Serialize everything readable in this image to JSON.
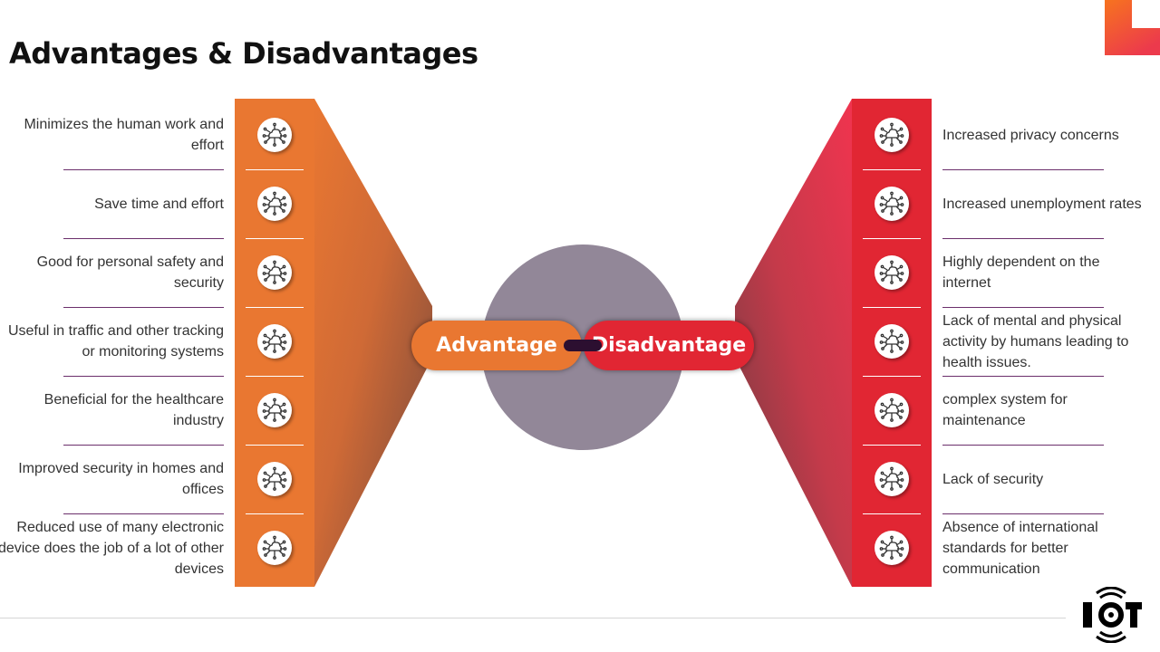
{
  "title": "Advantages & Disadvantages",
  "colors": {
    "advantage": "#e97731",
    "disadvantage": "#e12633",
    "center_circle": "#928798",
    "connector": "#2c0f30",
    "divider": "#6b2f6b"
  },
  "center": {
    "advantage_label": "Advantage",
    "disadvantage_label": "Disadvantage"
  },
  "advantages": [
    {
      "text": "Minimizes the human work and effort",
      "icon": "cloud-network-icon"
    },
    {
      "text": "Save time and effort",
      "icon": "cloud-network-icon"
    },
    {
      "text": "Good for personal safety and security",
      "icon": "cloud-network-icon"
    },
    {
      "text": "Useful in traffic and other tracking or monitoring systems",
      "icon": "cloud-network-icon"
    },
    {
      "text": "Beneficial for the healthcare industry",
      "icon": "cloud-network-icon"
    },
    {
      "text": "Improved security in homes and offices",
      "icon": "cloud-network-icon"
    },
    {
      "text": "Reduced use of many electronic device does the job of a lot of other devices",
      "icon": "cloud-network-icon"
    }
  ],
  "disadvantages": [
    {
      "text": "Increased privacy concerns",
      "icon": "cloud-network-icon"
    },
    {
      "text": "Increased unemployment rates",
      "icon": "cloud-network-icon"
    },
    {
      "text": "Highly dependent on the internet",
      "icon": "cloud-network-icon"
    },
    {
      "text": "Lack of mental and physical activity by humans leading to health issues.",
      "icon": "cloud-network-icon"
    },
    {
      "text": "complex system for maintenance",
      "icon": "cloud-network-icon"
    },
    {
      "text": "Lack of security",
      "icon": "cloud-network-icon"
    },
    {
      "text": "Absence of international standards for better communication",
      "icon": "cloud-network-icon"
    }
  ],
  "logo": {
    "text": "IOT"
  }
}
